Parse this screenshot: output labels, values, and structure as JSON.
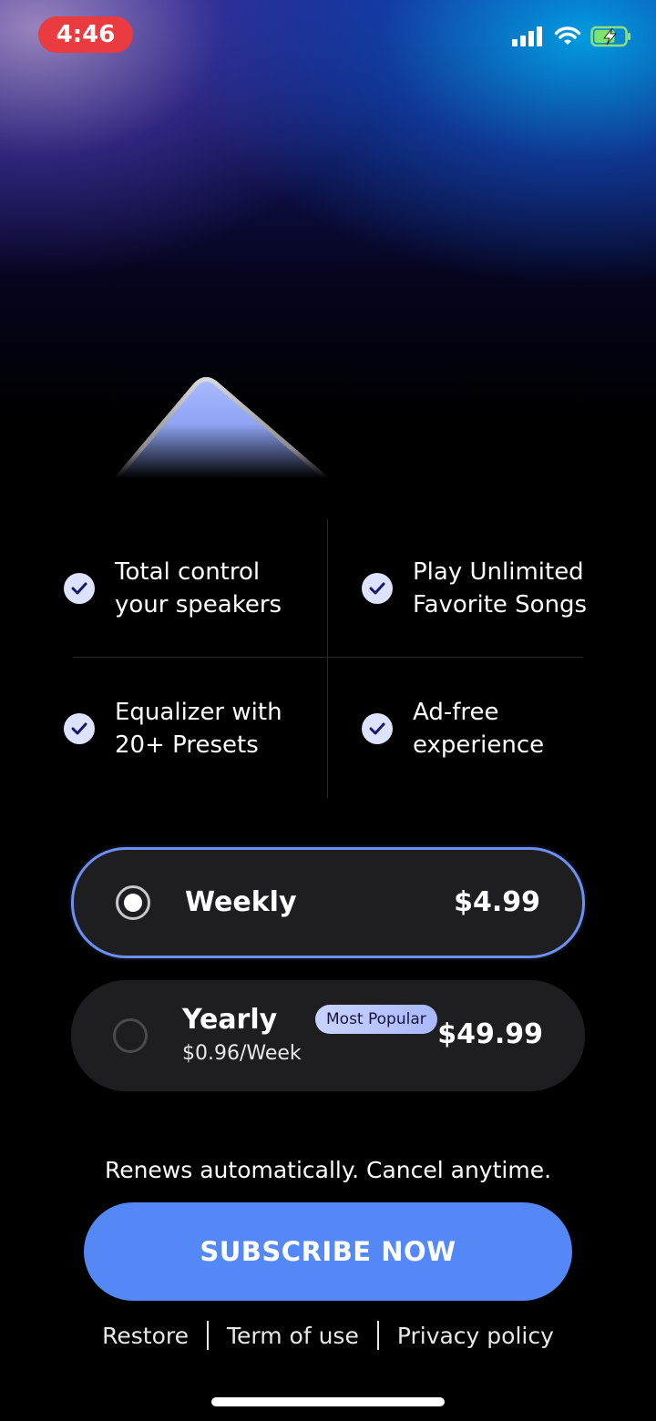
{
  "status_bar": {
    "time": "4:46"
  },
  "colors": {
    "accent": "#5488f7",
    "selected_border": "#6c8ff0",
    "card_background": "#1e1e21",
    "time_pill": "#ea3b40",
    "check_background": "#dde3ff"
  },
  "features": [
    {
      "text": "Total control\nyour speakers",
      "icon": "check-icon"
    },
    {
      "text": "Play Unlimited\nFavorite Songs",
      "icon": "check-icon"
    },
    {
      "text": "Equalizer with\n20+ Presets",
      "icon": "check-icon"
    },
    {
      "text": "Ad-free\nexperience",
      "icon": "check-icon"
    }
  ],
  "plans": [
    {
      "name": "Weekly",
      "price": "$4.99",
      "selected": true
    },
    {
      "name": "Yearly",
      "price": "$49.99",
      "subtitle": "$0.96/Week",
      "badge": "Most Popular",
      "selected": false
    }
  ],
  "renew_text": "Renews automatically. Cancel anytime.",
  "subscribe_label": "SUBSCRIBE NOW",
  "footer_links": [
    "Restore",
    "Term of use",
    "Privacy policy"
  ]
}
